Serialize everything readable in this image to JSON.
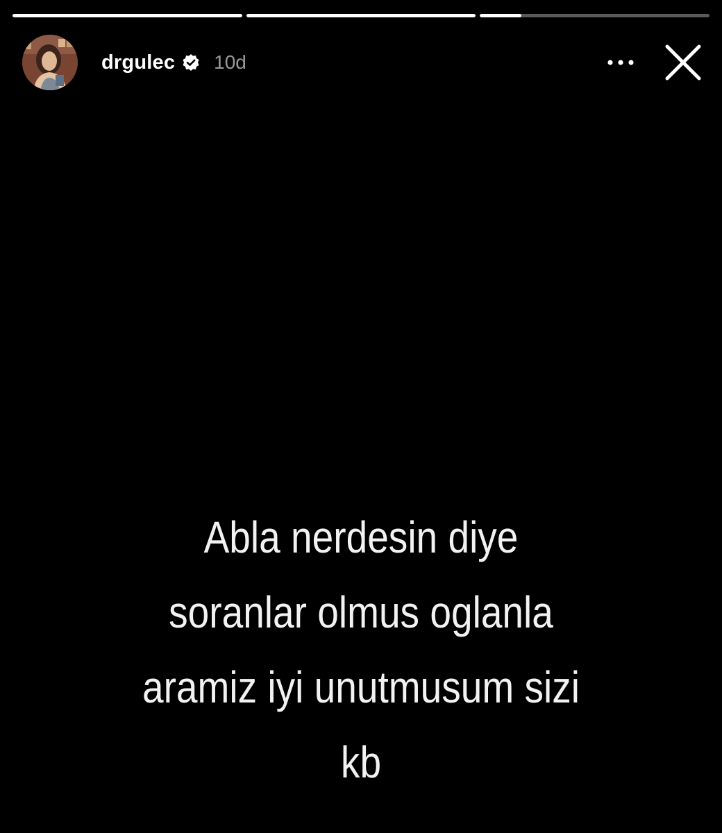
{
  "story": {
    "segments": [
      {
        "progress": 1.0
      },
      {
        "progress": 1.0
      },
      {
        "progress": 0.18
      }
    ],
    "author": {
      "username": "drgulec",
      "verified": true,
      "posted_ago": "10d"
    },
    "icons": {
      "verified": "verified-badge-icon",
      "more": "more-options-icon",
      "close": "close-icon"
    },
    "text_lines": [
      "Abla nerdesin diye",
      "soranlar olmus oglanla",
      "aramiz iyi unutmusum sizi",
      "kb"
    ]
  }
}
